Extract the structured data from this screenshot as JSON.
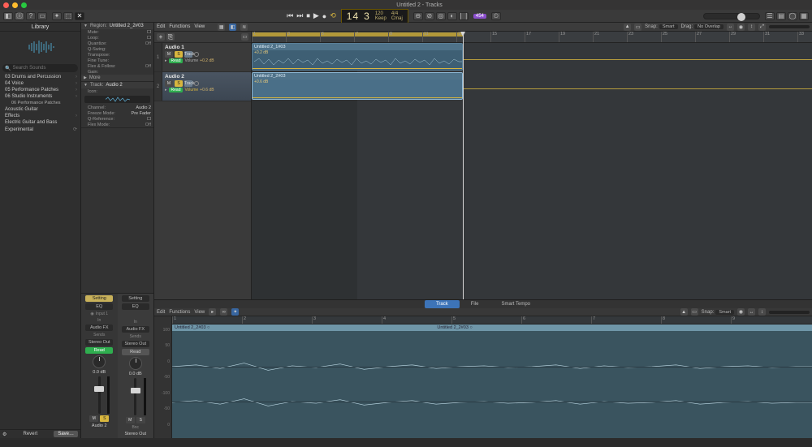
{
  "window_title": "Untitled 2 - Tracks",
  "lcd": {
    "bars": "14",
    "beats": "3",
    "tempo": "120",
    "tempo_label": "Keep",
    "sig": "4/4",
    "key": "Cmaj"
  },
  "mode_badge": "454",
  "toolbar": {
    "snap_label": "Snap:",
    "snap_value": "Smart",
    "drag_label": "Drag:",
    "drag_value": "No Overlap"
  },
  "library": {
    "title": "Library",
    "search_placeholder": "Search Sounds",
    "items": [
      "03 Drums and Percussion",
      "04 Voice",
      "05 Performance Patches",
      "06 Studio Instruments"
    ],
    "sub_item": "06 Performance Patches",
    "more_items": [
      "Acoustic Guitar",
      "Effects",
      "Electric Guitar and Bass",
      "Experimental"
    ],
    "revert": "Revert",
    "save": "Save…"
  },
  "inspector": {
    "region_label": "Region:",
    "region_name": "Untitled 2_2#03",
    "region_props": [
      {
        "k": "Mute:",
        "v": ""
      },
      {
        "k": "Loop:",
        "v": ""
      },
      {
        "k": "Quantize:",
        "v": "Off"
      },
      {
        "k": "Q-Swing:",
        "v": ""
      },
      {
        "k": "Transpose:",
        "v": ""
      },
      {
        "k": "Fine Tune:",
        "v": ""
      },
      {
        "k": "Flex & Follow:",
        "v": "Off"
      },
      {
        "k": "Gain:",
        "v": ""
      }
    ],
    "region_more": "More",
    "track_label": "Track:",
    "track_name": "Audio 2",
    "track_props": [
      {
        "k": "Icon:",
        "v": ""
      }
    ],
    "track_props2": [
      {
        "k": "Channel:",
        "v": "Audio 2"
      },
      {
        "k": "Freeze Mode:",
        "v": "Pre Fader"
      },
      {
        "k": "Q-Reference:",
        "v": ""
      },
      {
        "k": "Flex Mode:",
        "v": "Off"
      }
    ],
    "strip": {
      "setting": "Setting",
      "eq": "EQ",
      "input": "Input 1",
      "input_label": "In",
      "audiofx": "Audio FX",
      "sends": "Sends",
      "stereo_out": "Stereo Out",
      "read": "Read",
      "db": "0.0 dB",
      "mute": "M",
      "solo": "S",
      "name1": "Audio 2",
      "name2": "Stereo Out",
      "bnc": "Bnc"
    }
  },
  "tracks": {
    "menus": [
      "Edit",
      "Functions",
      "View"
    ],
    "rows": [
      {
        "num": "1",
        "name": "Audio 1",
        "db": "+0.2 dB"
      },
      {
        "num": "2",
        "name": "Audio 2",
        "db": "+0.6 dB"
      }
    ],
    "buttons": {
      "mute": "M",
      "solo": "S",
      "track": "Track",
      "read": "Read",
      "volume": "Volume"
    },
    "ruler": [
      "1",
      "3",
      "5",
      "7",
      "9",
      "11",
      "13",
      "15",
      "17",
      "19",
      "21",
      "23",
      "25",
      "27",
      "29",
      "31",
      "33"
    ],
    "regions": [
      {
        "name": "Untitled 2_1#03",
        "db": "+0.2 dB"
      },
      {
        "name": "Untitled 2_2#03",
        "db": "+0.6 dB"
      }
    ]
  },
  "editor": {
    "tabs": [
      "Track",
      "File",
      "Smart Tempo"
    ],
    "menus": [
      "Edit",
      "Functions",
      "View"
    ],
    "snap_label": "Snap:",
    "snap_value": "Smart",
    "ruler": [
      "1",
      "2",
      "3",
      "4",
      "5",
      "6",
      "7",
      "8",
      "9"
    ],
    "clip_name": "Untitled 2_2#03",
    "gutter": [
      "100",
      "50",
      "0",
      "-50",
      "-100",
      "-50",
      "0"
    ]
  }
}
